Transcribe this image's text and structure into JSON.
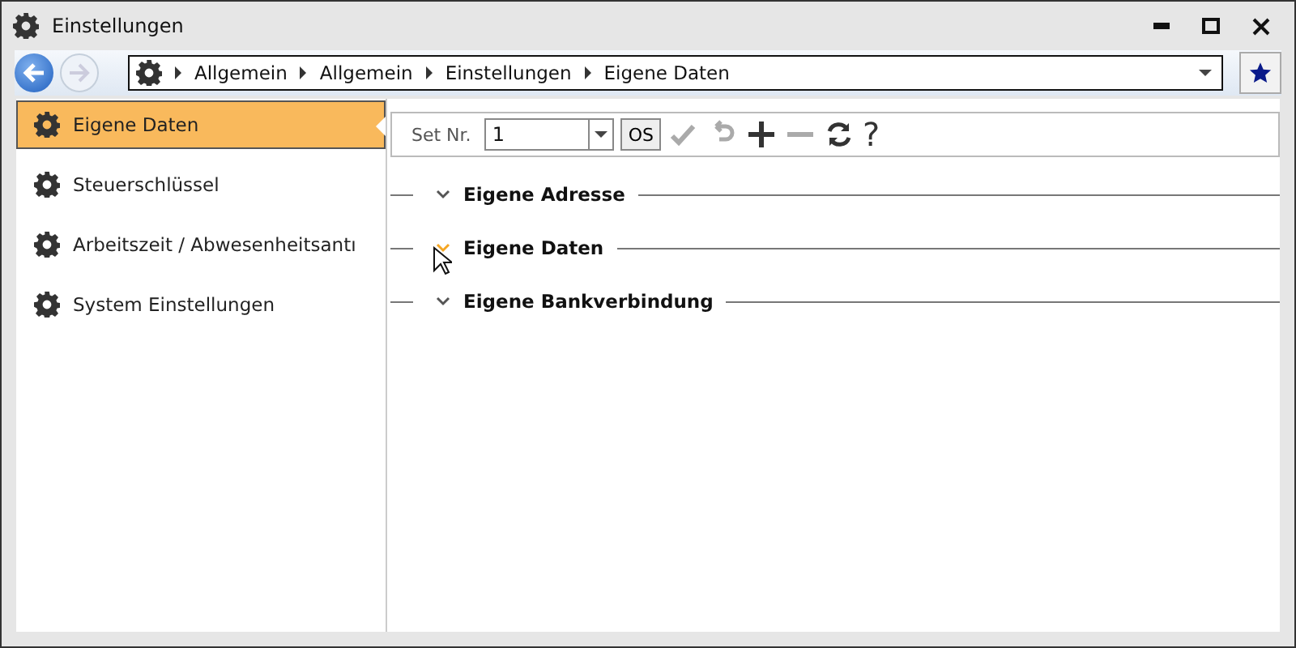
{
  "window": {
    "title": "Einstellungen"
  },
  "breadcrumb": [
    "Allgemein",
    "Allgemein",
    "Einstellungen",
    "Eigene Daten"
  ],
  "sidebar": {
    "items": [
      {
        "label": "Eigene Daten",
        "selected": true
      },
      {
        "label": "Steuerschlüssel",
        "selected": false
      },
      {
        "label": "Arbeitszeit / Abwesenheitsantı",
        "selected": false
      },
      {
        "label": "System Einstellungen",
        "selected": false
      }
    ]
  },
  "toolbar": {
    "set_label": "Set Nr.",
    "set_value": "1",
    "os_button": "OS",
    "help": "?",
    "tools": [
      {
        "kind": "check",
        "disabled": true
      },
      {
        "kind": "undo",
        "disabled": true
      },
      {
        "kind": "plus",
        "disabled": false
      },
      {
        "kind": "minus",
        "disabled": true
      },
      {
        "kind": "refresh",
        "disabled": false
      }
    ]
  },
  "sections": [
    {
      "title": "Eigene Adresse",
      "hovered": false
    },
    {
      "title": "Eigene Daten",
      "hovered": true
    },
    {
      "title": "Eigene Bankverbindung",
      "hovered": false
    }
  ]
}
